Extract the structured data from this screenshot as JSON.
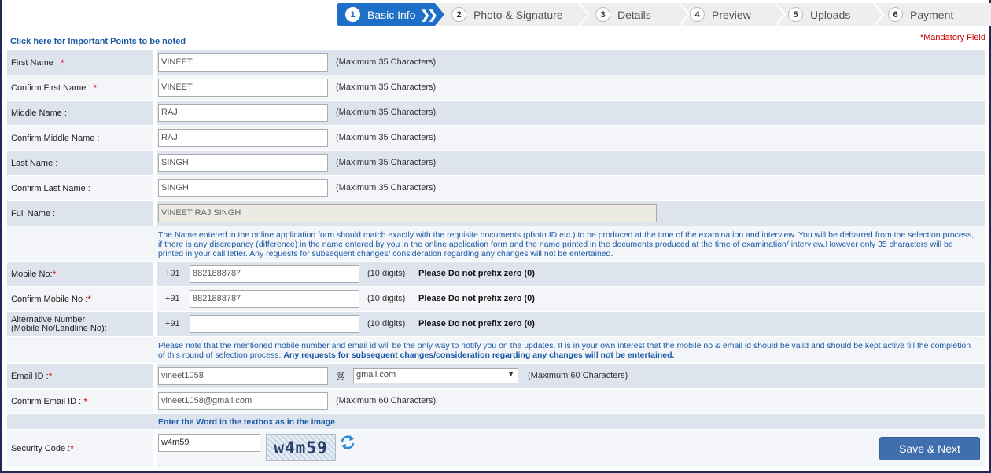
{
  "stepper": [
    {
      "num": "1",
      "label": "Basic Info",
      "active": true
    },
    {
      "num": "2",
      "label": "Photo & Signature"
    },
    {
      "num": "3",
      "label": "Details"
    },
    {
      "num": "4",
      "label": "Preview"
    },
    {
      "num": "5",
      "label": "Uploads"
    },
    {
      "num": "6",
      "label": "Payment"
    }
  ],
  "header": {
    "important_link": "Click here for Important Points to be noted",
    "mandatory": "*Mandatory Field"
  },
  "fields": {
    "first_name": {
      "label": "First Name :",
      "value": "VINEET",
      "hint": "(Maximum 35 Characters)"
    },
    "confirm_first_name": {
      "label": "Confirm First Name :",
      "value": "VINEET",
      "hint": "(Maximum 35 Characters)"
    },
    "middle_name": {
      "label": "Middle Name :",
      "value": "RAJ",
      "hint": "(Maximum 35 Characters)"
    },
    "confirm_middle_name": {
      "label": "Confirm Middle Name :",
      "value": "RAJ",
      "hint": "(Maximum 35 Characters)"
    },
    "last_name": {
      "label": "Last Name :",
      "value": "SINGH",
      "hint": "(Maximum 35 Characters)"
    },
    "confirm_last_name": {
      "label": "Confirm Last Name :",
      "value": "SINGH",
      "hint": "(Maximum 35 Characters)"
    },
    "full_name": {
      "label": "Full Name :",
      "value": "VINEET RAJ SINGH"
    },
    "name_note": "The Name entered in the online application form should match exactly with the requisite documents (photo ID etc.) to be produced at the time of the examination and interview. You will be debarred from the selection process, if there is any discrepancy (difference) in the name entered by you in the online application form and the name printed in the documents produced at the time of examination/ interview.However only 35 characters will be printed in your call letter. Any requests for subsequent changes/ consideration regarding any changes will not be entertained.",
    "mobile": {
      "label": "Mobile No:",
      "prefix": "+91",
      "value": "8821888787",
      "hint": "(10 digits)",
      "warn": "Please Do not prefix zero (0)"
    },
    "confirm_mobile": {
      "label": "Confirm Mobile No :",
      "prefix": "+91",
      "value": "8821888787",
      "hint": "(10 digits)",
      "warn": "Please Do not prefix zero (0)"
    },
    "alt_number": {
      "label_line1": "Alternative Number",
      "label_line2": "(Mobile No/Landline No):",
      "prefix": "+91",
      "value": "",
      "hint": "(10 digits)",
      "warn": "Please Do not prefix zero (0)"
    },
    "contact_note_plain": "Please note that the mentioned mobile number and email id will be the only way to notify you on the updates. It is in your own interest that the mobile no & email id should be valid and should be kept active till the completion of this round of selection process.",
    "contact_note_bold": "Any requests for subsequent changes/consideration regarding any changes will not be entertained.",
    "email": {
      "label": "Email ID :",
      "value": "vineet1058",
      "at": "@",
      "domain": "gmail.com",
      "hint": "(Maximum 60 Characters)"
    },
    "confirm_email": {
      "label": "Confirm Email ID :",
      "value": "vineet1058@gmail.com",
      "hint": "(Maximum 60 Characters)"
    },
    "captcha_instruction": "Enter the Word in the textbox as in the image",
    "security": {
      "label": "Security Code :",
      "value": "w4m59",
      "captcha_text": "w4m59"
    }
  },
  "actions": {
    "save_next": "Save & Next"
  },
  "icons": {
    "refresh": "refresh-icon",
    "chevrons": "double-chevron-icon",
    "dropdown": "dropdown-arrow-icon"
  },
  "colors": {
    "accent": "#1e6fc7",
    "row_shade": "#dde4ee",
    "required": "#cc0000",
    "note_text": "#1a5aa6",
    "button": "#3f6fae"
  }
}
